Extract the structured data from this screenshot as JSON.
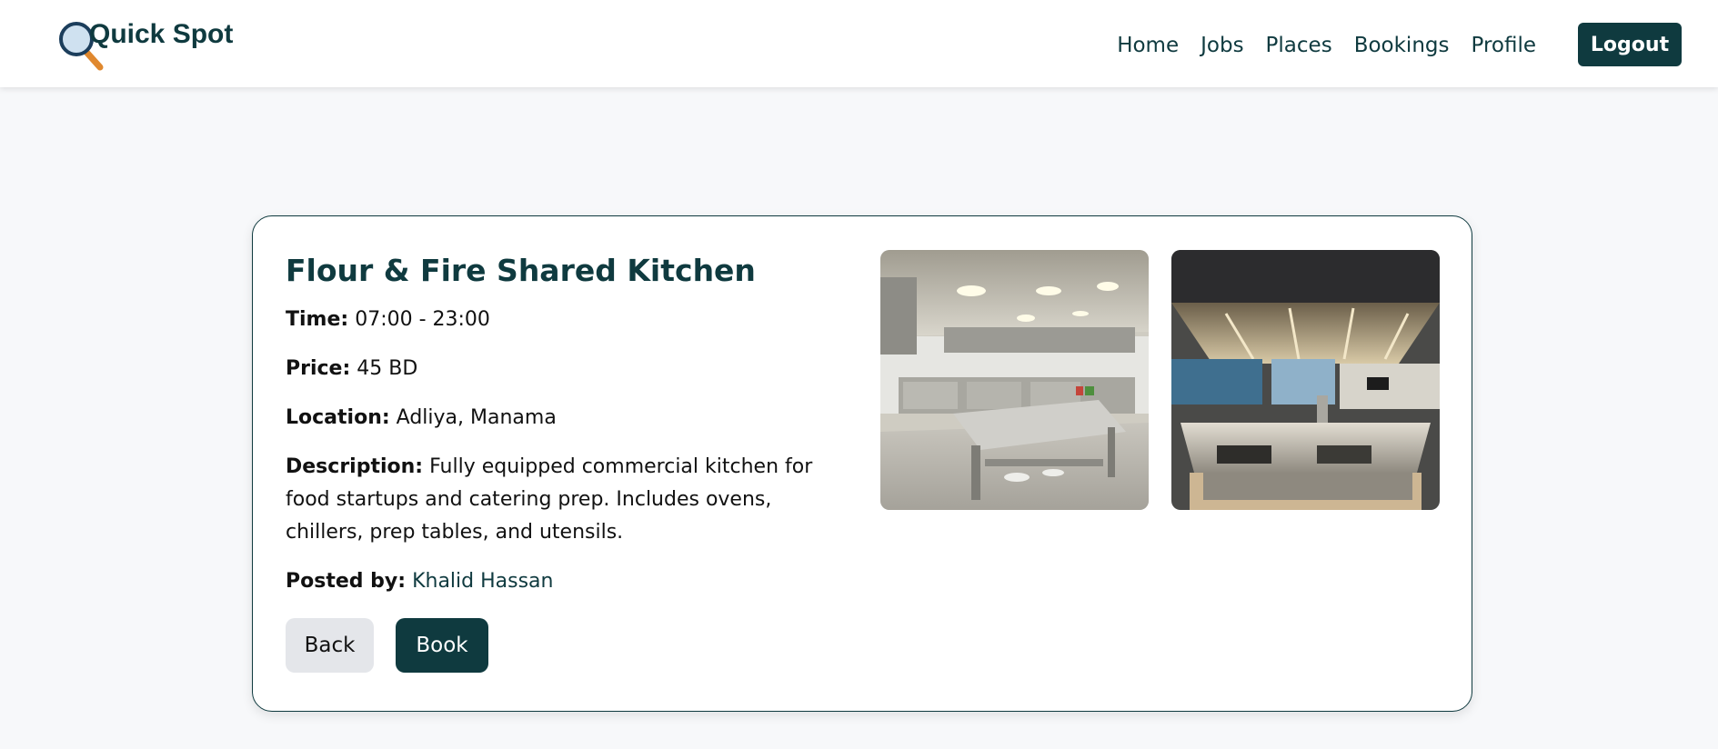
{
  "app": {
    "name": "Quick Spot"
  },
  "nav": {
    "items": [
      "Home",
      "Jobs",
      "Places",
      "Bookings",
      "Profile"
    ],
    "logout_label": "Logout"
  },
  "place": {
    "title": "Flour & Fire Shared Kitchen",
    "time_label": "Time:",
    "time_value": "07:00 - 23:00",
    "price_label": "Price:",
    "price_value": "45 BD",
    "location_label": "Location:",
    "location_value": "Adliya, Manama",
    "description_label": "Description:",
    "description_value": "Fully equipped commercial kitchen for food startups and catering prep. Includes ovens, chillers, prep tables, and utensils.",
    "posted_by_label": "Posted by:",
    "posted_by_value": "Khalid Hassan",
    "photos": [
      "kitchen-photo-1",
      "kitchen-photo-2"
    ]
  },
  "actions": {
    "back_label": "Back",
    "book_label": "Book"
  },
  "colors": {
    "primary": "#0f3a3f",
    "background": "#f7f8fa",
    "secondary_button": "#e4e6ea"
  }
}
